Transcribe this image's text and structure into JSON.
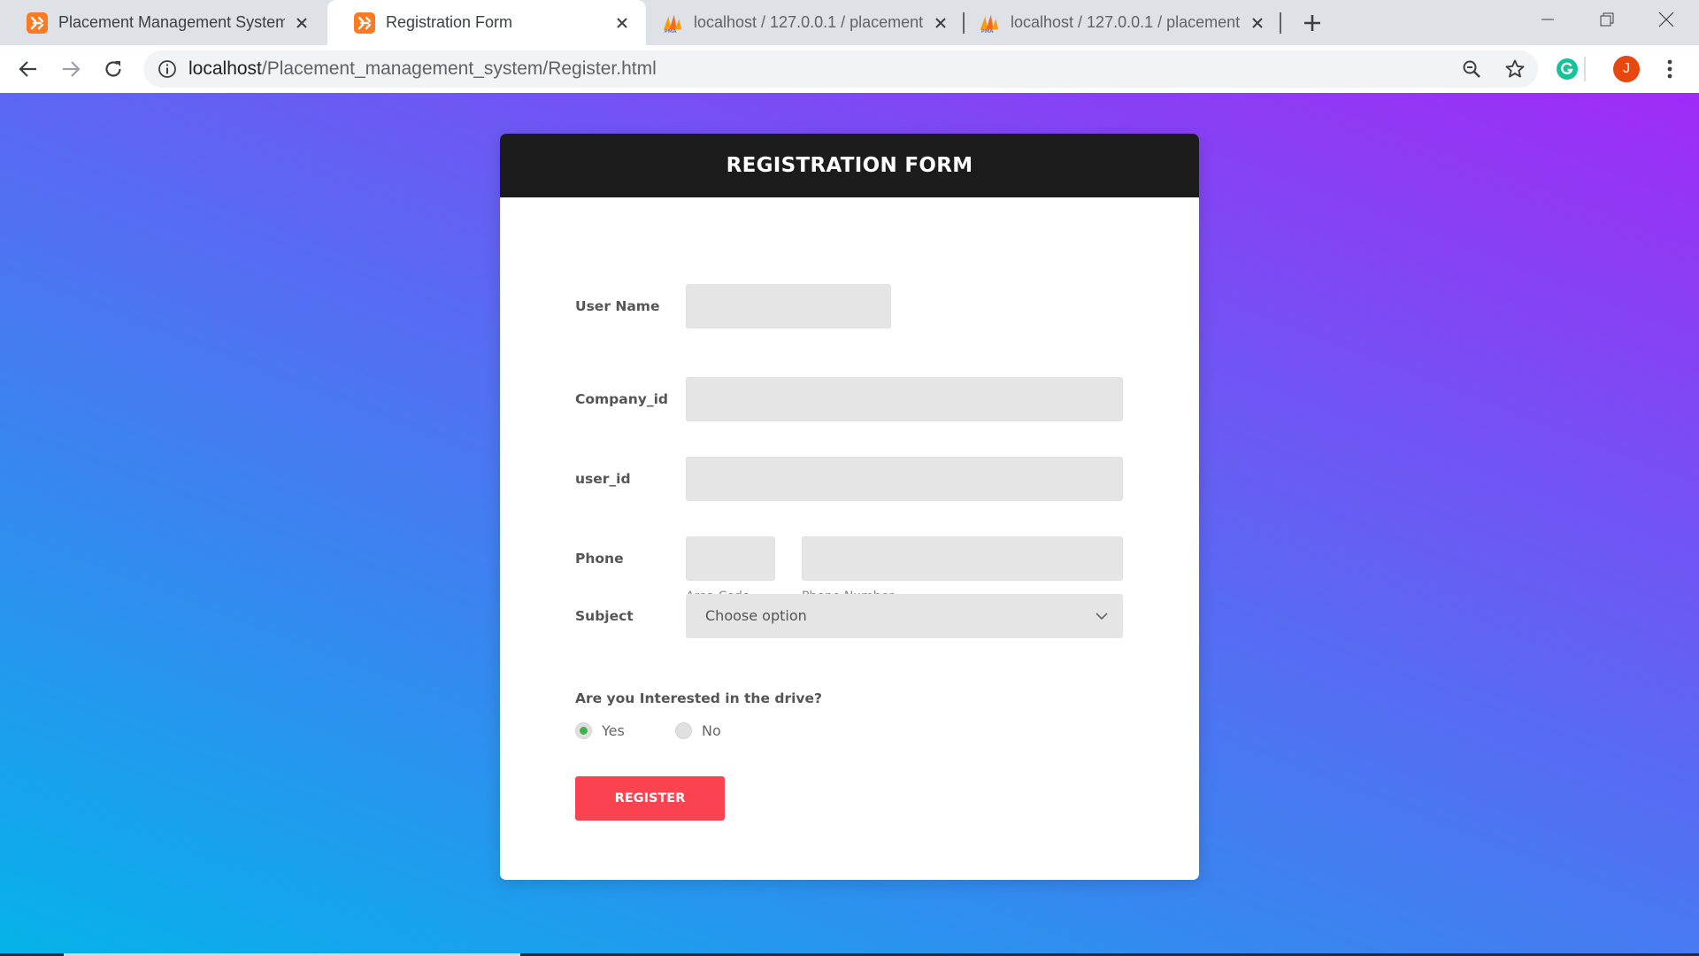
{
  "browser": {
    "tabs": [
      {
        "title": "Placement Management System",
        "icon": "xampp-icon",
        "active": false
      },
      {
        "title": "Registration Form",
        "icon": "xampp-icon",
        "active": true
      },
      {
        "title": "localhost / 127.0.0.1 / placement",
        "icon": "phpmyadmin-icon",
        "active": false
      },
      {
        "title": "localhost / 127.0.0.1 / placement",
        "icon": "phpmyadmin-icon",
        "active": false
      }
    ],
    "address": {
      "host": "localhost",
      "path": "/Placement_management_system/Register.html"
    },
    "profile_initial": "J",
    "colors": {
      "xampp": "#fb7a24",
      "profile": "#e8470f",
      "grammarly": "#15c39a"
    }
  },
  "form": {
    "title": "REGISTRATION FORM",
    "fields": {
      "username": {
        "label": "User Name",
        "value": ""
      },
      "company_id": {
        "label": "Company_id",
        "value": ""
      },
      "user_id": {
        "label": "user_id",
        "value": ""
      },
      "phone": {
        "label": "Phone",
        "area_code_hint": "Area Code",
        "number_hint": "Phone Number",
        "area_code": "",
        "number": ""
      },
      "subject": {
        "label": "Subject",
        "selected": "Choose option"
      }
    },
    "drive": {
      "question": "Are you Interested in the drive?",
      "options": [
        {
          "label": "Yes",
          "checked": true
        },
        {
          "label": "No",
          "checked": false
        }
      ]
    },
    "submit_label": "REGISTER",
    "colors": {
      "header_bg": "#1c1c1c",
      "button": "#fa4251",
      "radio_checked": "#43b049",
      "gradient_start": "#05b3ea",
      "gradient_end": "#a02bf6"
    }
  }
}
